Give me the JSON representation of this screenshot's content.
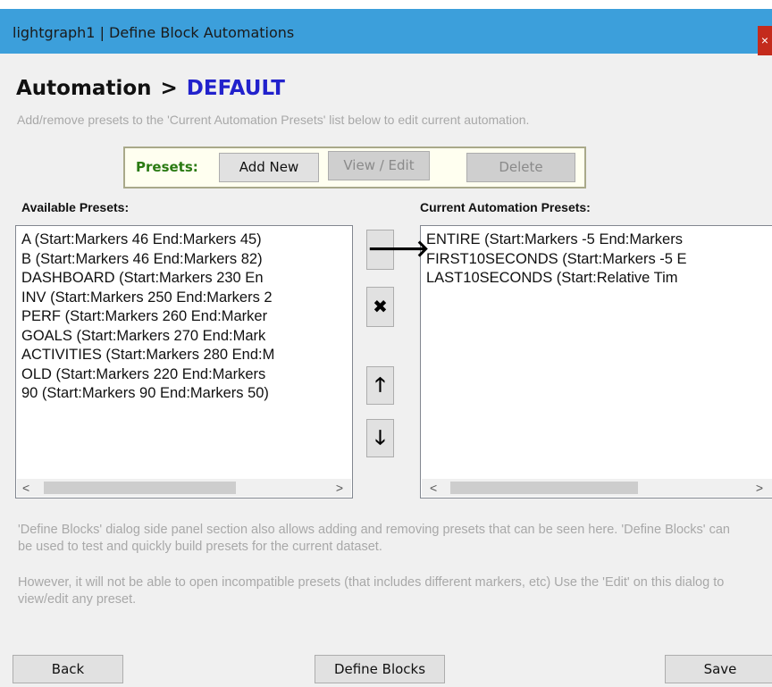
{
  "window": {
    "title": "lightgraph1 | Define Block Automations",
    "close_label": "×"
  },
  "heading": {
    "prefix": "Automation",
    "separator": ">",
    "automation_name": "DEFAULT"
  },
  "hint": "Add/remove presets to the 'Current Automation Presets' list below to edit current automation.",
  "presets_toolbar": {
    "label": "Presets:",
    "add_new": "Add New",
    "view_edit": "View / Edit",
    "delete": "Delete"
  },
  "available": {
    "label": "Available Presets:",
    "items": [
      "A (Start:Markers 46 End:Markers 45)",
      "B (Start:Markers 46 End:Markers 82)",
      "DASHBOARD (Start:Markers 230 En",
      "INV (Start:Markers 250 End:Markers 2",
      "PERF (Start:Markers 260 End:Marker",
      "GOALS (Start:Markers 270 End:Mark",
      "ACTIVITIES (Start:Markers 280 End:M",
      "OLD (Start:Markers 220 End:Markers",
      "90 (Start:Markers 90 End:Markers 50)"
    ]
  },
  "current": {
    "label": "Current Automation Presets:",
    "items": [
      "ENTIRE (Start:Markers -5 End:Markers",
      "FIRST10SECONDS (Start:Markers -5 E",
      "LAST10SECONDS (Start:Relative Tim"
    ]
  },
  "scroll": {
    "left": "<",
    "right": ">"
  },
  "move_buttons": {
    "add": "🡒",
    "remove": "✖",
    "up": "🡑",
    "down": "🡓"
  },
  "notes": [
    "'Define Blocks' dialog side panel section also allows adding and removing presets that can be seen here.  'Define Blocks' can be used to test and quickly build presets for the current dataset.",
    "However, it will not be able to open incompatible presets (that includes different markers, etc) Use the 'Edit' on this dialog to view/edit any preset."
  ],
  "footer": {
    "back": "Back",
    "define_blocks": "Define Blocks",
    "save": "Save"
  },
  "colors": {
    "titlebar": "#3c9fdb",
    "automation_name": "#2222cc",
    "presets_label": "#2a7a12",
    "close": "#c42b1c"
  }
}
